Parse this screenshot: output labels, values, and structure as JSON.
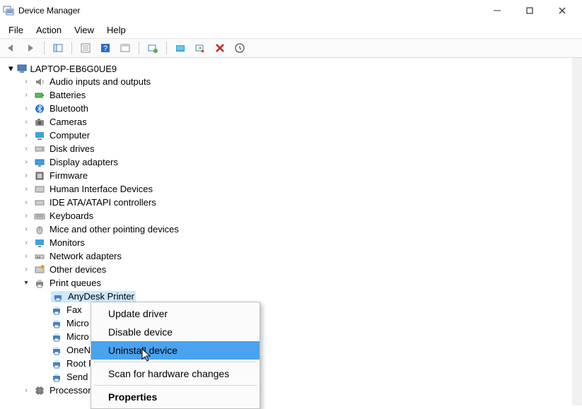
{
  "window": {
    "title": "Device Manager"
  },
  "menu": {
    "file": "File",
    "action": "Action",
    "view": "View",
    "help": "Help"
  },
  "tree": {
    "root": "LAPTOP-EB6G0UE9",
    "categories": [
      "Audio inputs and outputs",
      "Batteries",
      "Bluetooth",
      "Cameras",
      "Computer",
      "Disk drives",
      "Display adapters",
      "Firmware",
      "Human Interface Devices",
      "IDE ATA/ATAPI controllers",
      "Keyboards",
      "Mice and other pointing devices",
      "Monitors",
      "Network adapters",
      "Other devices",
      "Print queues",
      "Processors"
    ],
    "print_queues": [
      "AnyDesk Printer",
      "Fax",
      "Micro",
      "Micro",
      "OneN",
      "Root P",
      "Send T"
    ]
  },
  "context_menu": {
    "update": "Update driver",
    "disable": "Disable device",
    "uninstall": "Uninstall device",
    "scan": "Scan for hardware changes",
    "properties": "Properties"
  }
}
